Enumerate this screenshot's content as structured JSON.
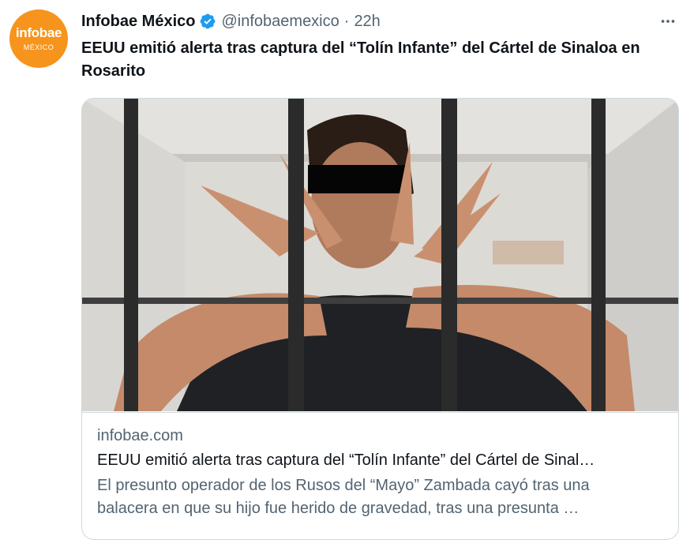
{
  "account": {
    "avatar_brand": "infobae",
    "avatar_sub": "MÉXICO",
    "name": "Infobae México",
    "handle": "@infobaemexico",
    "separator": "·",
    "time": "22h"
  },
  "tweet": {
    "text": "EEUU emitió alerta tras captura del “Tolín Infante” del Cártel de Sinaloa en Rosarito"
  },
  "card": {
    "domain": "infobae.com",
    "title": "EEUU emitió alerta tras captura del “Tolín Infante” del Cártel de Sinal…",
    "description_line1": "El presunto operador de los Rusos del “Mayo” Zambada cayó tras una",
    "description_line2": "balacera en que su hijo fue herido de gravedad, tras una presunta …"
  },
  "icons": {
    "verified": "verified-badge-icon",
    "more": "more-options-icon"
  },
  "colors": {
    "brand_orange": "#f7941d",
    "verified_blue": "#1d9bf0",
    "secondary_text": "#536471",
    "border": "#cfd9de"
  }
}
